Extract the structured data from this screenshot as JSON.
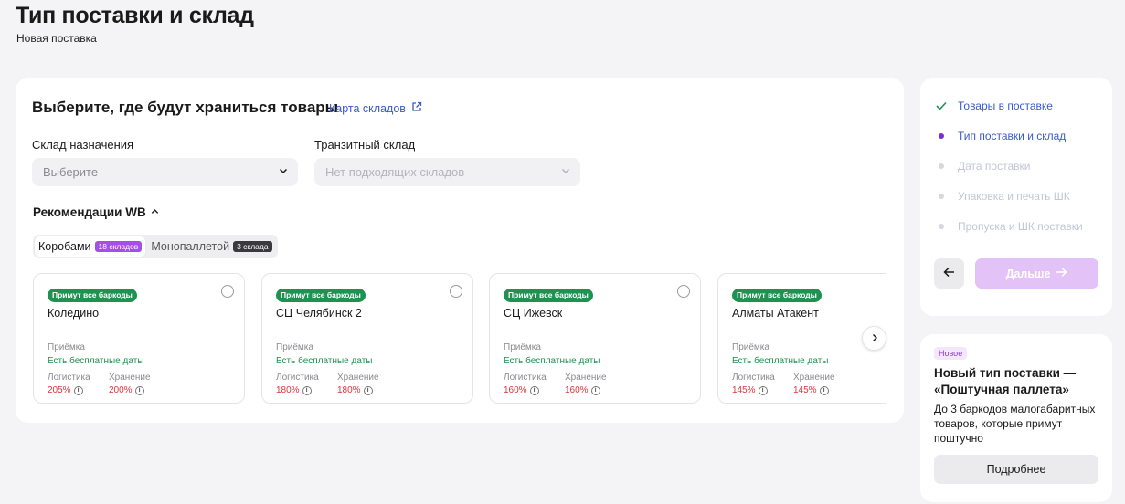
{
  "page": {
    "title": "Тип поставки и склад",
    "subtitle": "Новая поставка"
  },
  "main": {
    "section_title": "Выберите, где будут храниться товары",
    "map_link": "Карта складов",
    "destination": {
      "label": "Склад назначения",
      "placeholder": "Выберите"
    },
    "transit": {
      "label": "Транзитный склад",
      "placeholder": "Нет подходящих складов"
    },
    "recommendations_title": "Рекомендации WB",
    "tabs": [
      {
        "label": "Коробами",
        "badge": "18 складов",
        "badge_color": "#a64ee8",
        "active": true
      },
      {
        "label": "Монопаллетой",
        "badge": "3 склада",
        "badge_color": "#3a3a3e",
        "active": false
      }
    ],
    "warehouses": [
      {
        "badge": "Примут все баркоды",
        "name": "Коледино",
        "acceptance_label": "Приёмка",
        "acceptance_value": "Есть бесплатные даты",
        "logistics_label": "Логистика",
        "logistics_value": "205%",
        "storage_label": "Хранение",
        "storage_value": "200%"
      },
      {
        "badge": "Примут все баркоды",
        "name": "СЦ Челябинск 2",
        "acceptance_label": "Приёмка",
        "acceptance_value": "Есть бесплатные даты",
        "logistics_label": "Логистика",
        "logistics_value": "180%",
        "storage_label": "Хранение",
        "storage_value": "180%"
      },
      {
        "badge": "Примут все баркоды",
        "name": "СЦ Ижевск",
        "acceptance_label": "Приёмка",
        "acceptance_value": "Есть бесплатные даты",
        "logistics_label": "Логистика",
        "logistics_value": "160%",
        "storage_label": "Хранение",
        "storage_value": "160%"
      },
      {
        "badge": "Примут все баркоды",
        "name": "Алматы Атакент",
        "acceptance_label": "Приёмка",
        "acceptance_value": "Есть бесплатные даты",
        "logistics_label": "Логистика",
        "logistics_value": "145%",
        "storage_label": "Хранение",
        "storage_value": "145%"
      }
    ]
  },
  "steps": {
    "items": [
      {
        "label": "Товары в поставке",
        "state": "done",
        "color": "#3b5bc7"
      },
      {
        "label": "Тип поставки и склад",
        "state": "current",
        "color": "#3b5bc7"
      },
      {
        "label": "Дата поставки",
        "state": "pending",
        "color": "#c4c6d6"
      },
      {
        "label": "Упаковка и печать ШК",
        "state": "pending",
        "color": "#c4c6d6"
      },
      {
        "label": "Пропуска и ШК поставки",
        "state": "pending",
        "color": "#c4c6d6"
      }
    ],
    "next_label": "Дальше"
  },
  "promo": {
    "badge": "Новое",
    "title": "Новый тип поставки — «Поштучная паллета»",
    "text": "До 3 баркодов малогабаритных товаров, которые примут поштучно",
    "button": "Подробнее"
  },
  "colors": {
    "accent": "#a64ee8",
    "link": "#3b5bc7",
    "green": "#1f9150",
    "red": "#e0353f"
  }
}
